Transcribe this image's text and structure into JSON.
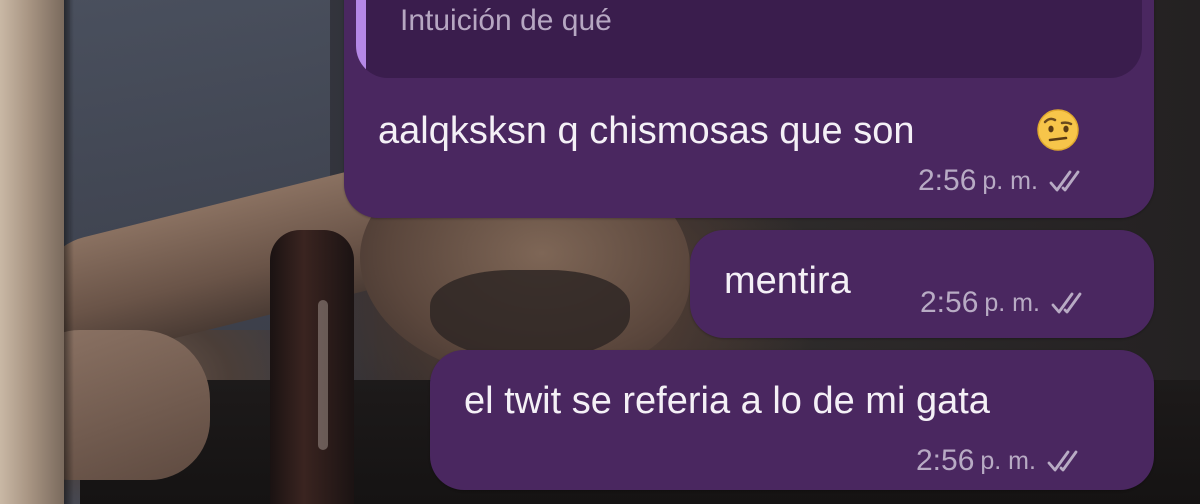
{
  "conversation": {
    "quoted_reply": {
      "text": "Intuición de qué"
    },
    "messages": [
      {
        "text": "aalqksksn q chismosas que son",
        "emoji": "face-with-raised-eyebrow",
        "time": "2:56",
        "period": "p. m.",
        "status": "read-double-check"
      },
      {
        "text": "mentira",
        "time": "2:56",
        "period": "p. m.",
        "status": "read-double-check"
      },
      {
        "text": "el twit se referia a lo de mi gata",
        "time": "2:56",
        "period": "p. m.",
        "status": "read-double-check"
      }
    ]
  },
  "colors": {
    "bubble": "#4a2760",
    "reply_background": "#3a1d4d",
    "reply_bar": "#b588e6",
    "text": "#f4f0f6",
    "meta": "#b8abc4"
  }
}
